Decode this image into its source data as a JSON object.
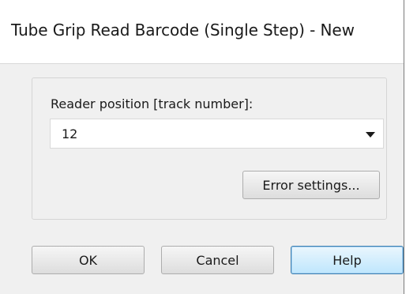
{
  "dialog": {
    "title": "Tube Grip Read Barcode (Single Step) - New"
  },
  "reader_position": {
    "label": "Reader position [track number]:",
    "selected_value": "12"
  },
  "buttons": {
    "error_settings": "Error settings...",
    "ok": "OK",
    "cancel": "Cancel",
    "help": "Help"
  },
  "icons": {
    "dropdown": "chevron-down-icon"
  },
  "colors": {
    "dialog_background": "#f0f0f0",
    "title_background": "#ffffff",
    "default_button_border": "#3c7fb1"
  }
}
